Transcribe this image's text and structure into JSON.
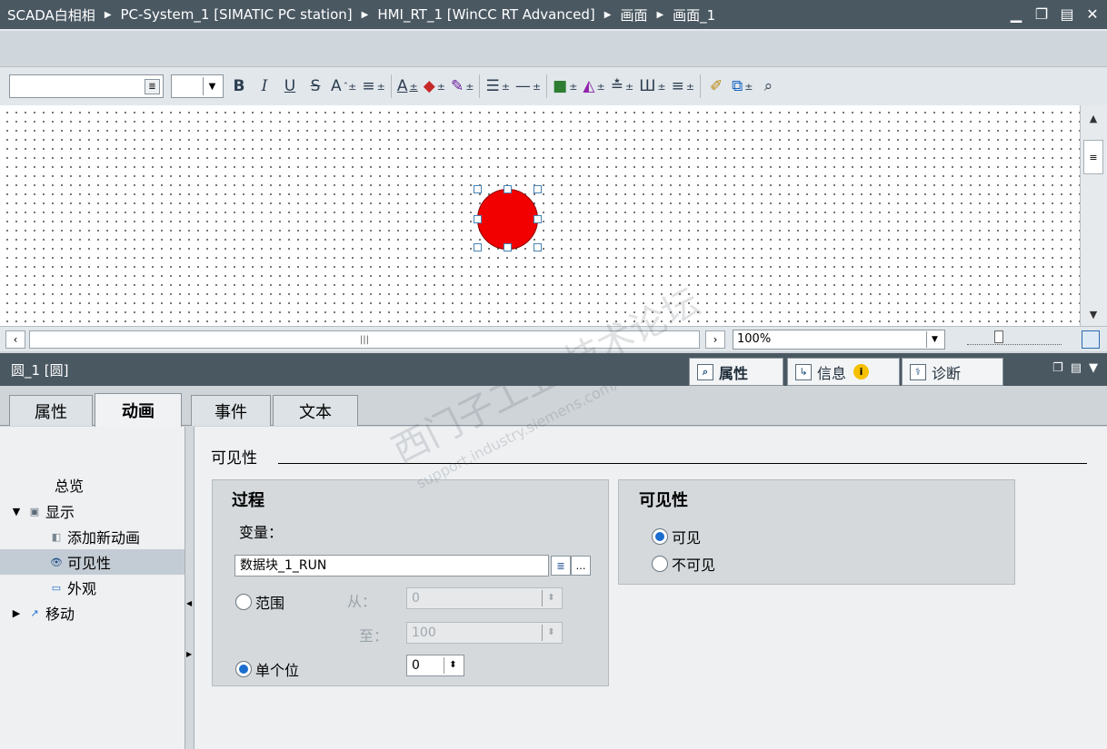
{
  "breadcrumb": [
    "SCADA白相相",
    "PC-System_1 [SIMATIC PC station]",
    "HMI_RT_1 [WinCC RT Advanced]",
    "画面",
    "画面_1"
  ],
  "toolbar": {
    "font_name": "",
    "font_size": "",
    "bold": "B",
    "italic": "I",
    "underline": "U",
    "strike": "S",
    "font_grow": "A",
    "align": "≡",
    "font_color": "A"
  },
  "canvas": {
    "object_shape": "circle",
    "object_color": "#f20000",
    "zoom": "100%"
  },
  "properties": {
    "object_title": "圆_1 [圆]",
    "tabs": [
      {
        "label": "属性",
        "icon": "properties-icon"
      },
      {
        "label": "信息",
        "icon": "info-icon"
      },
      {
        "label": "诊断",
        "icon": "diagnostics-icon"
      }
    ],
    "sub_tabs": [
      "属性",
      "动画",
      "事件",
      "文本"
    ],
    "active_sub_tab": "动画"
  },
  "tree": {
    "items": [
      {
        "label": "总览"
      },
      {
        "label": "显示"
      },
      {
        "label": "添加新动画"
      },
      {
        "label": "可见性"
      },
      {
        "label": "外观"
      },
      {
        "label": "移动"
      }
    ]
  },
  "visibility": {
    "section_title": "可见性",
    "process": {
      "title": "过程",
      "variable_label": "变量：",
      "variable_value": "数据块_1_RUN",
      "range_label": "范围",
      "from_label": "从：",
      "from_value": "0",
      "to_label": "至：",
      "to_value": "100",
      "single_bit_label": "单个位",
      "single_bit_value": "0"
    },
    "visibility_group": {
      "title": "可见性",
      "visible_label": "可见",
      "invisible_label": "不可见",
      "selected": "可见"
    }
  },
  "watermark": {
    "text": "西门子工业 技术论坛",
    "url": "support.industry.siemens.com/cs"
  }
}
